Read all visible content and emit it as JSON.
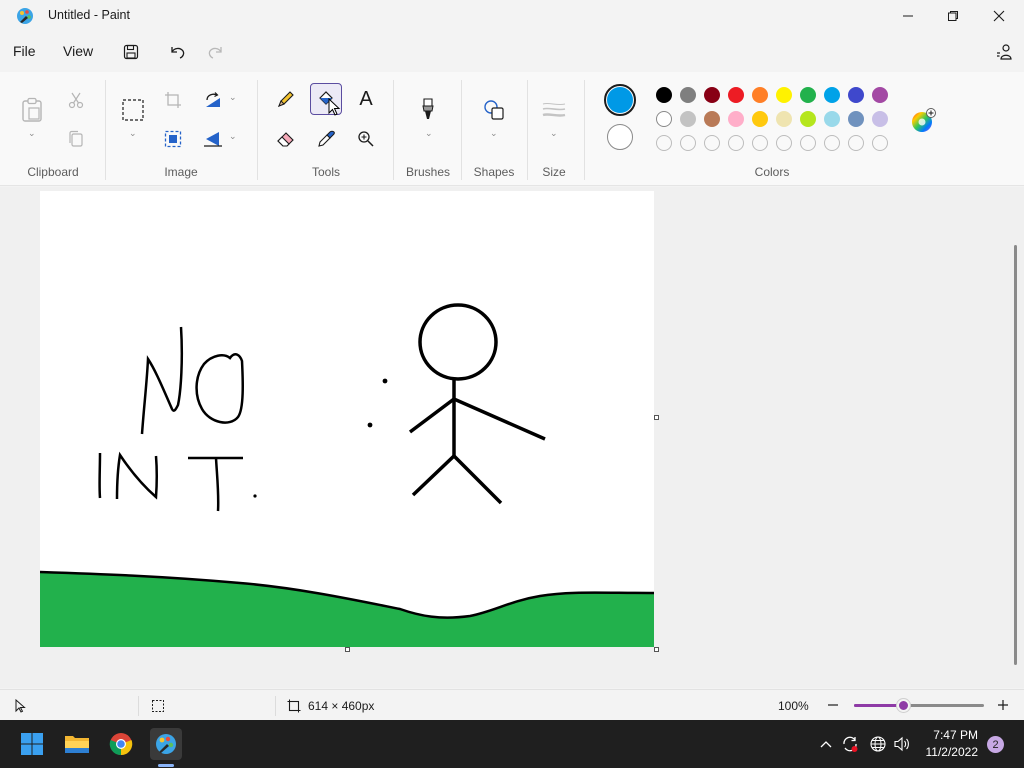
{
  "window": {
    "title": "Untitled - Paint"
  },
  "menu": {
    "file": "File",
    "view": "View"
  },
  "ribbon": {
    "groups": {
      "clipboard": "Clipboard",
      "image": "Image",
      "tools": "Tools",
      "brushes": "Brushes",
      "shapes": "Shapes",
      "size": "Size",
      "colors": "Colors"
    },
    "text_tool_glyph": "A",
    "active_tool": "fill-icon"
  },
  "colors": {
    "primary": "#0099e6",
    "secondary": "#ffffff",
    "palette_row1": [
      "#000000",
      "#7f7f7f",
      "#880015",
      "#ed1c24",
      "#ff7f27",
      "#fff200",
      "#22b14c",
      "#00a2e8",
      "#3f48cc",
      "#a349a4"
    ],
    "palette_row2": [
      "#ffffff",
      "#c3c3c3",
      "#b97a57",
      "#ffaec9",
      "#ffc90e",
      "#efe4b0",
      "#b5e61d",
      "#99d9ea",
      "#7092be",
      "#c8bfe7"
    ],
    "custom_slots": 10,
    "accent": "#8e3aa6"
  },
  "canvas": {
    "background": "#ffffff",
    "ground_color": "#22b14c",
    "stroke_color": "#000000"
  },
  "status": {
    "size": "614 × 460px",
    "zoom": "100%",
    "zoom_fraction": 0.38
  },
  "taskbar": {
    "time": "7:47 PM",
    "date": "11/2/2022",
    "notifications": "2"
  }
}
